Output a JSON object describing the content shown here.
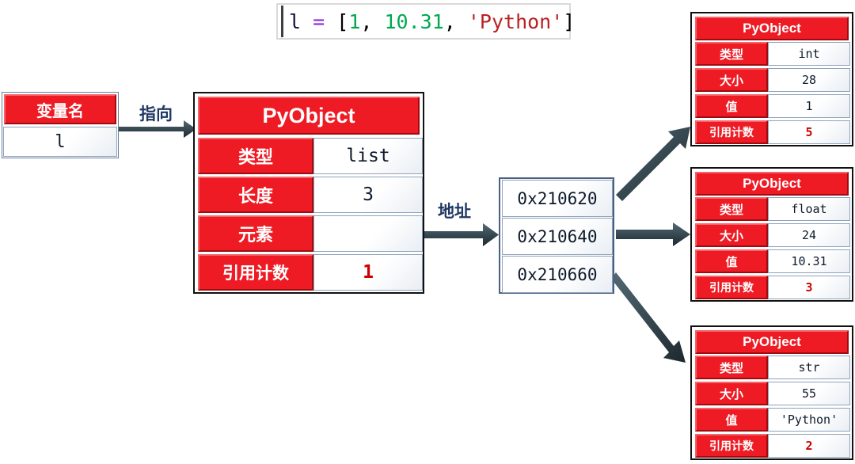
{
  "code_line": {
    "tokens": [
      {
        "text": "l",
        "kind": "var"
      },
      {
        "text": " ",
        "kind": "punc"
      },
      {
        "text": "=",
        "kind": "op"
      },
      {
        "text": " ",
        "kind": "punc"
      },
      {
        "text": "[",
        "kind": "punc"
      },
      {
        "text": "1",
        "kind": "num"
      },
      {
        "text": ", ",
        "kind": "punc"
      },
      {
        "text": "10.31",
        "kind": "num"
      },
      {
        "text": ", ",
        "kind": "punc"
      },
      {
        "text": "'Python'",
        "kind": "str"
      },
      {
        "text": "]",
        "kind": "punc"
      }
    ],
    "full_text": "l = [1, 10.31, 'Python']"
  },
  "variable_box": {
    "header": "变量名",
    "value": "l"
  },
  "labels": {
    "points_to": "指向",
    "address": "地址"
  },
  "main_object": {
    "title": "PyObject",
    "rows": [
      {
        "label": "类型",
        "value": "list",
        "value_is_red": false
      },
      {
        "label": "长度",
        "value": "3",
        "value_is_red": false
      },
      {
        "label": "元素",
        "value": "",
        "value_is_red": false
      },
      {
        "label": "引用计数",
        "value": "1",
        "value_is_red": true
      }
    ]
  },
  "addresses": [
    "0x210620",
    "0x210640",
    "0x210660"
  ],
  "element_objects": [
    {
      "title": "PyObject",
      "rows": [
        {
          "label": "类型",
          "value": "int",
          "value_is_red": false
        },
        {
          "label": "大小",
          "value": "28",
          "value_is_red": false
        },
        {
          "label": "值",
          "value": "1",
          "value_is_red": false
        },
        {
          "label": "引用计数",
          "value": "5",
          "value_is_red": true
        }
      ]
    },
    {
      "title": "PyObject",
      "rows": [
        {
          "label": "类型",
          "value": "float",
          "value_is_red": false
        },
        {
          "label": "大小",
          "value": "24",
          "value_is_red": false
        },
        {
          "label": "值",
          "value": "10.31",
          "value_is_red": false
        },
        {
          "label": "引用计数",
          "value": "3",
          "value_is_red": true
        }
      ]
    },
    {
      "title": "PyObject",
      "rows": [
        {
          "label": "类型",
          "value": "str",
          "value_is_red": false
        },
        {
          "label": "大小",
          "value": "55",
          "value_is_red": false
        },
        {
          "label": "值",
          "value": "'Python'",
          "value_is_red": false
        },
        {
          "label": "引用计数",
          "value": "2",
          "value_is_red": true
        }
      ]
    }
  ],
  "colors": {
    "red_header": "#ee1b24",
    "arrow": "#3a4c55",
    "annotation_text": "#1f3864",
    "refcount_value": "#cc0000",
    "code_string": "#ba2121",
    "code_number": "#00a84f",
    "code_operator": "#8a2be2"
  },
  "arrows": [
    {
      "name": "var-to-main",
      "from": "variable-box",
      "to": "main-pyobject"
    },
    {
      "name": "elements-to-addr",
      "from": "main-elements",
      "to": "address-list"
    },
    {
      "name": "addr0-to-int",
      "from": "address-0",
      "to": "pyobject-int"
    },
    {
      "name": "addr1-to-float",
      "from": "address-1",
      "to": "pyobject-float"
    },
    {
      "name": "addr2-to-str",
      "from": "address-2",
      "to": "pyobject-str"
    }
  ]
}
